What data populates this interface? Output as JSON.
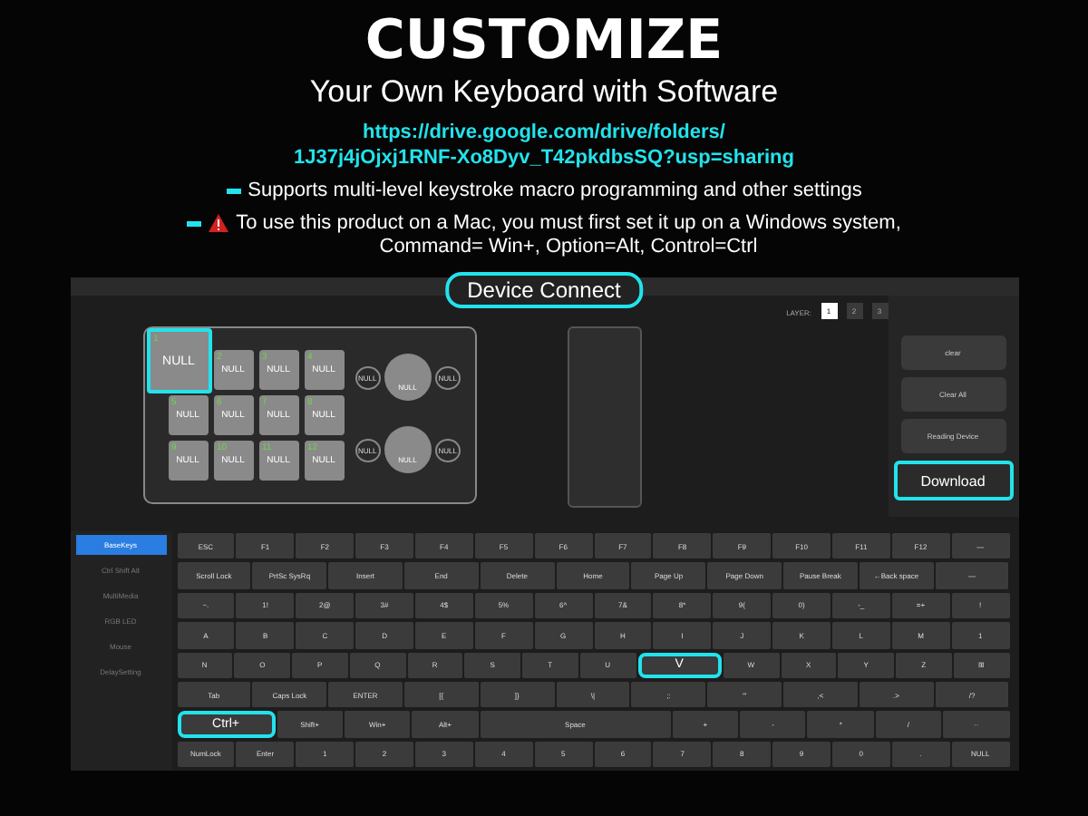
{
  "header": {
    "title": "CUSTOMIZE",
    "subtitle": "Your Own Keyboard with Software",
    "link_lines": [
      "https://drive.google.com/drive/folders/",
      "1J37j4jOjxj1RNF-Xo8Dyv_T42pkdbsSQ?usp=sharing"
    ],
    "notes": [
      {
        "text": "Supports multi-level keystroke macro programming and other settings",
        "warning": false
      },
      {
        "text": "To use this product on a Mac, you must first set it up on a Windows system,",
        "warning": true,
        "second_line": "Command= Win+, Option=Alt, Control=Ctrl"
      }
    ]
  },
  "app": {
    "connect_label": "Device Connect",
    "layer_label": "LAYER:",
    "layers": [
      {
        "label": "1",
        "selected": true
      },
      {
        "label": "2",
        "selected": false
      },
      {
        "label": "3",
        "selected": false
      }
    ],
    "pad_keys": [
      {
        "number": "1",
        "label": "NULL",
        "highlighted": true
      },
      {
        "number": "2",
        "label": "NULL",
        "highlighted": false
      },
      {
        "number": "3",
        "label": "NULL",
        "highlighted": false
      },
      {
        "number": "4",
        "label": "NULL",
        "highlighted": false
      },
      {
        "number": "5",
        "label": "NULL",
        "highlighted": false
      },
      {
        "number": "6",
        "label": "NULL",
        "highlighted": false
      },
      {
        "number": "7",
        "label": "NULL",
        "highlighted": false
      },
      {
        "number": "8",
        "label": "NULL",
        "highlighted": false
      },
      {
        "number": "9",
        "label": "NULL",
        "highlighted": false
      },
      {
        "number": "10",
        "label": "NULL",
        "highlighted": false
      },
      {
        "number": "11",
        "label": "NULL",
        "highlighted": false
      },
      {
        "number": "12",
        "label": "NULL",
        "highlighted": false
      }
    ],
    "knobs": [
      {
        "left": "NULL",
        "center": "NULL",
        "right": "NULL"
      },
      {
        "left": "NULL",
        "center": "NULL",
        "right": "NULL"
      }
    ],
    "actions": [
      {
        "label": "clear",
        "highlighted": false
      },
      {
        "label": "Clear All",
        "highlighted": false
      },
      {
        "label": "Reading Device",
        "highlighted": false
      },
      {
        "label": "Download",
        "highlighted": true
      }
    ],
    "sidebar": [
      {
        "label": "BaseKeys",
        "selected": true
      },
      {
        "label": "Ctrl Shift Alt",
        "selected": false
      },
      {
        "label": "MultiMedia",
        "selected": false
      },
      {
        "label": "RGB LED",
        "selected": false
      },
      {
        "label": "Mouse",
        "selected": false
      },
      {
        "label": "DelaySetting",
        "selected": false
      }
    ],
    "key_rows": [
      [
        {
          "label": "ESC"
        },
        {
          "label": "F1"
        },
        {
          "label": "F2"
        },
        {
          "label": "F3"
        },
        {
          "label": "F4"
        },
        {
          "label": "F5"
        },
        {
          "label": "F6"
        },
        {
          "label": "F7"
        },
        {
          "label": "F8"
        },
        {
          "label": "F9"
        },
        {
          "label": "F10"
        },
        {
          "label": "F11"
        },
        {
          "label": "F12"
        },
        {
          "label": "—"
        }
      ],
      [
        {
          "label": "Scroll Lock"
        },
        {
          "label": "PrtSc SysRq"
        },
        {
          "label": "Insert"
        },
        {
          "label": "End"
        },
        {
          "label": "Delete"
        },
        {
          "label": "Home"
        },
        {
          "label": "Page Up"
        },
        {
          "label": "Page Down"
        },
        {
          "label": "Pause Break"
        },
        {
          "label": "←Back space"
        },
        {
          "label": "—"
        }
      ],
      [
        {
          "label": "~."
        },
        {
          "label": "1!"
        },
        {
          "label": "2@"
        },
        {
          "label": "3#"
        },
        {
          "label": "4$"
        },
        {
          "label": "5%"
        },
        {
          "label": "6^"
        },
        {
          "label": "7&"
        },
        {
          "label": "8*"
        },
        {
          "label": "9("
        },
        {
          "label": "0)"
        },
        {
          "label": "-_"
        },
        {
          "label": "=+"
        },
        {
          "label": "!"
        }
      ],
      [
        {
          "label": "A"
        },
        {
          "label": "B"
        },
        {
          "label": "C"
        },
        {
          "label": "D"
        },
        {
          "label": "E"
        },
        {
          "label": "F"
        },
        {
          "label": "G"
        },
        {
          "label": "H"
        },
        {
          "label": "I"
        },
        {
          "label": "J"
        },
        {
          "label": "K"
        },
        {
          "label": "L"
        },
        {
          "label": "M"
        },
        {
          "label": "1"
        }
      ],
      [
        {
          "label": "N"
        },
        {
          "label": "O"
        },
        {
          "label": "P"
        },
        {
          "label": "Q"
        },
        {
          "label": "R"
        },
        {
          "label": "S"
        },
        {
          "label": "T"
        },
        {
          "label": "U"
        },
        {
          "label": "V",
          "highlighted": true
        },
        {
          "label": "W"
        },
        {
          "label": "X"
        },
        {
          "label": "Y"
        },
        {
          "label": "Z"
        },
        {
          "label": "⊞"
        }
      ],
      [
        {
          "label": "Tab"
        },
        {
          "label": "Caps Lock"
        },
        {
          "label": "ENTER"
        },
        {
          "label": "[{"
        },
        {
          "label": "]}"
        },
        {
          "label": "\\|"
        },
        {
          "label": ";:"
        },
        {
          "label": "'\""
        },
        {
          "label": ",<"
        },
        {
          "label": ".>"
        },
        {
          "label": "/?"
        }
      ],
      [
        {
          "label": "Ctrl+",
          "highlighted": true
        },
        {
          "label": "Shift+"
        },
        {
          "label": "Win+"
        },
        {
          "label": "Alt+"
        },
        {
          "label": "Space",
          "kind": "wide"
        },
        {
          "label": "+"
        },
        {
          "label": "-"
        },
        {
          "label": "*"
        },
        {
          "label": "/"
        },
        {
          "label": "··"
        }
      ],
      [
        {
          "label": "NumLock"
        },
        {
          "label": "Enter"
        },
        {
          "label": "1"
        },
        {
          "label": "2"
        },
        {
          "label": "3"
        },
        {
          "label": "4"
        },
        {
          "label": "5"
        },
        {
          "label": "6"
        },
        {
          "label": "7"
        },
        {
          "label": "8"
        },
        {
          "label": "9"
        },
        {
          "label": "0"
        },
        {
          "label": "."
        },
        {
          "label": "NULL"
        }
      ]
    ]
  }
}
